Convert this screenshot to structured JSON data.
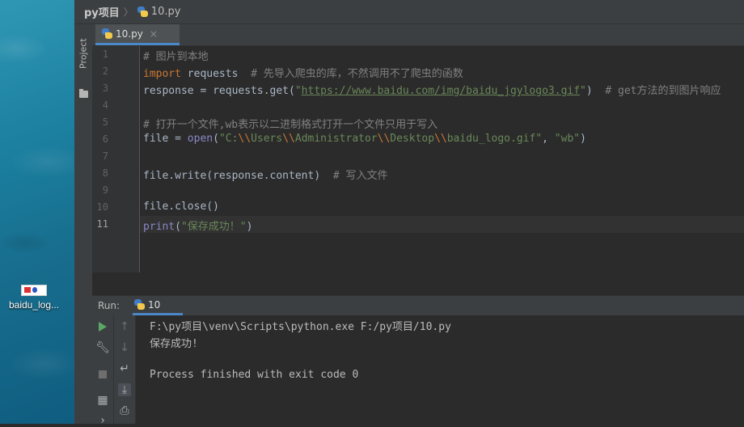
{
  "desktop": {
    "icon_label": "baidu_log..."
  },
  "navbar": {
    "project": "py项目",
    "separator": "〉",
    "file": "10.py"
  },
  "sidebar": {
    "project_tab": "Project"
  },
  "editor_tabs": [
    {
      "label": "10.py",
      "close": "×"
    }
  ],
  "editor": {
    "line_numbers": [
      "1",
      "2",
      "3",
      "4",
      "5",
      "6",
      "7",
      "8",
      "9",
      "10",
      "11"
    ],
    "current_line": 11,
    "lines": [
      [
        {
          "t": "# 图片到本地",
          "c": "cmt"
        }
      ],
      [
        {
          "t": "import",
          "c": "kw"
        },
        {
          "t": " requests  "
        },
        {
          "t": "# 先导入爬虫的库，不然调用不了爬虫的函数",
          "c": "cmt"
        }
      ],
      [
        {
          "t": "response = requests.get("
        },
        {
          "t": "\"",
          "c": "str"
        },
        {
          "t": "https://www.baidu.com/img/baidu_jgylogo3.gif",
          "c": "url"
        },
        {
          "t": "\"",
          "c": "str"
        },
        {
          "t": ")  "
        },
        {
          "t": "# get方法的到图片响应",
          "c": "cmt"
        }
      ],
      [],
      [
        {
          "t": "# 打开一个文件,wb表示以二进制格式打开一个文件只用于写入",
          "c": "cmt"
        }
      ],
      [
        {
          "t": "file = "
        },
        {
          "t": "open",
          "c": "builtin"
        },
        {
          "t": "("
        },
        {
          "t": "\"C:",
          "c": "str"
        },
        {
          "t": "\\\\",
          "c": "esc"
        },
        {
          "t": "Users",
          "c": "str"
        },
        {
          "t": "\\\\",
          "c": "esc"
        },
        {
          "t": "Administrator",
          "c": "str"
        },
        {
          "t": "\\\\",
          "c": "esc"
        },
        {
          "t": "Desktop",
          "c": "str"
        },
        {
          "t": "\\\\",
          "c": "esc"
        },
        {
          "t": "baidu_logo.gif\"",
          "c": "str"
        },
        {
          "t": ", "
        },
        {
          "t": "\"wb\"",
          "c": "str"
        },
        {
          "t": ")"
        }
      ],
      [],
      [
        {
          "t": "file.write(response.content)  "
        },
        {
          "t": "# 写入文件",
          "c": "cmt"
        }
      ],
      [],
      [
        {
          "t": "file.close()"
        }
      ],
      [
        {
          "t": "print",
          "c": "builtin"
        },
        {
          "t": "("
        },
        {
          "t": "\"保存成功！\"",
          "c": "str"
        },
        {
          "t": ")"
        }
      ]
    ]
  },
  "run": {
    "label": "Run:",
    "tab": "10",
    "output": [
      "F:\\py项目\\venv\\Scripts\\python.exe F:/py项目/10.py",
      "保存成功!",
      "",
      "Process finished with exit code 0"
    ],
    "icons": [
      "rerun-icon",
      "wrench-icon",
      "stop-icon",
      "layout-icon",
      "up-arrow-icon",
      "down-arrow-icon",
      "soft-wrap-icon",
      "scroll-to-end-icon",
      "print-icon"
    ]
  }
}
